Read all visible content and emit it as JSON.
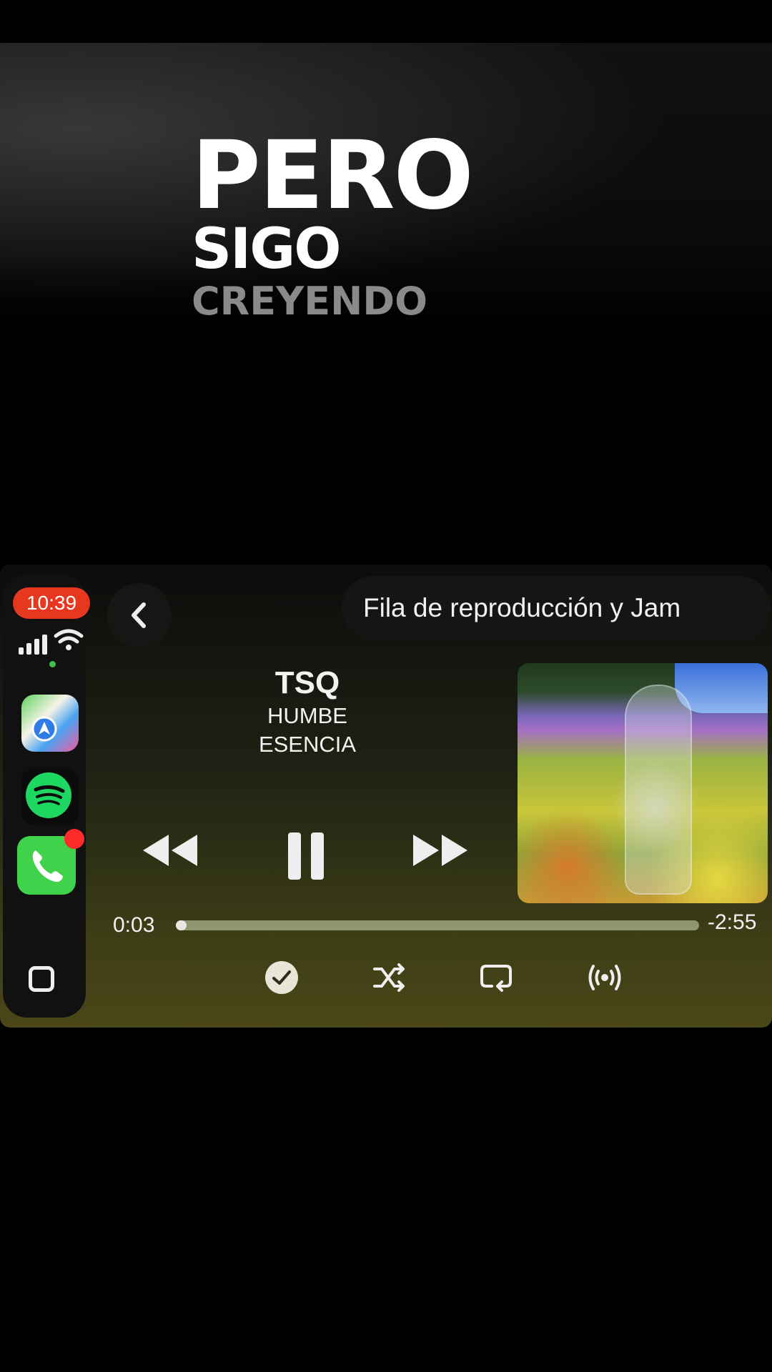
{
  "lyrics": {
    "line1": "PERO",
    "line2": "SIGO",
    "line3": "CREYENDO"
  },
  "status": {
    "time": "10:39"
  },
  "dock": {
    "apps": [
      {
        "name": "Maps",
        "icon": "maps-icon"
      },
      {
        "name": "Spotify",
        "icon": "spotify-icon"
      },
      {
        "name": "Phone",
        "icon": "phone-icon"
      }
    ],
    "home_icon": "app-switcher-icon"
  },
  "header": {
    "queue_label": "Fila de reproducción y Jam"
  },
  "track": {
    "title": "TSQ",
    "artist": "HUMBE",
    "album": "ESENCIA"
  },
  "playback": {
    "elapsed": "0:03",
    "remaining": "-2:55",
    "progress": 0.017
  },
  "colors": {
    "time_pill": "#e7371f",
    "badge": "#ff2a2a",
    "phone": "#3fd24a",
    "spotify": "#1ed760"
  }
}
